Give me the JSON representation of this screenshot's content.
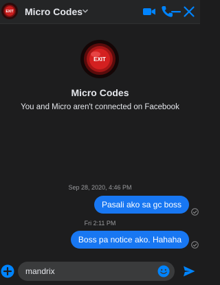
{
  "header": {
    "title": "Micro Codes",
    "avatar_text": "EXIT"
  },
  "profile": {
    "name": "Micro Codes",
    "subtitle": "You and Micro aren't connected on Facebook",
    "avatar_text": "EXIT"
  },
  "messages": [
    {
      "timestamp": "Sep 28, 2020, 4:46 PM",
      "text": "Pasali ako sa gc boss"
    },
    {
      "timestamp": "Fri 2:11 PM",
      "text": "Boss pa notice ako. Hahaha"
    }
  ],
  "composer": {
    "value": "mandrix"
  },
  "icons": {
    "video": "video-call-icon",
    "phone": "phone-icon",
    "minimize": "minimize-icon",
    "close": "close-icon",
    "plus": "plus-icon",
    "emoji": "emoji-icon",
    "send": "send-icon",
    "seen": "sent-check-icon"
  },
  "colors": {
    "accent": "#0084ff",
    "bubble": "#1877f2",
    "background": "#1d1d1e",
    "exit_sign": "#c81e1e"
  }
}
